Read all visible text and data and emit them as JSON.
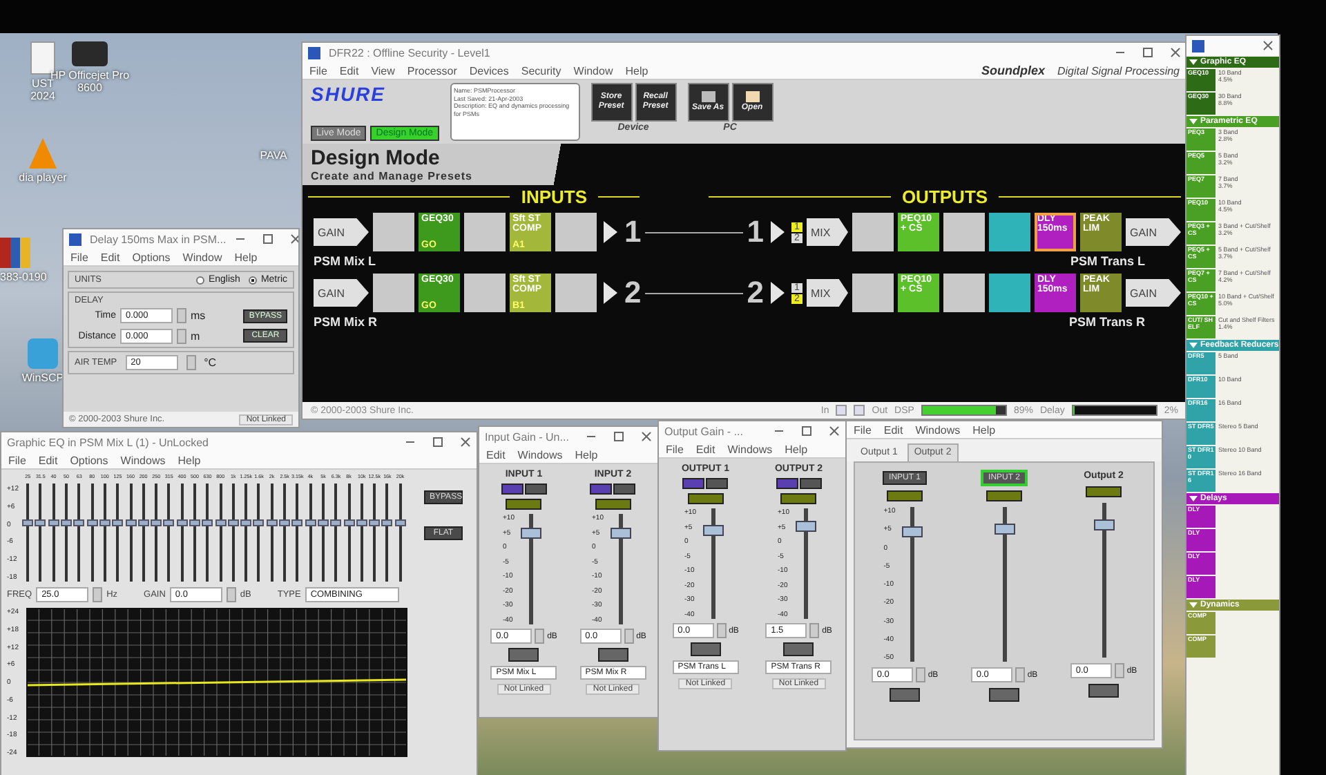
{
  "desktop_icons": [
    {
      "kind": "doc",
      "lines": [
        "UST",
        "2024"
      ]
    },
    {
      "kind": "printer",
      "lines": [
        "HP Officejet Pro",
        "8600"
      ]
    },
    {
      "kind": "cone",
      "lines": [
        "dia player"
      ]
    },
    {
      "kind": "archive",
      "lines": [
        "383-0190"
      ]
    },
    {
      "kind": "lock",
      "lines": [
        "WinSCP"
      ]
    },
    {
      "kind": "none",
      "lines": [
        "PAVA"
      ]
    }
  ],
  "main_window": {
    "title": "DFR22 : Offline Security - Level1",
    "menu": [
      "File",
      "Edit",
      "View",
      "Processor",
      "Devices",
      "Security",
      "Window",
      "Help"
    ],
    "brand": "Soundplex",
    "brand_sub": "Digital Signal Processing",
    "logo": "SHURE",
    "modes": [
      {
        "label": "Live Mode",
        "selected": false
      },
      {
        "label": "Design Mode",
        "selected": true
      }
    ],
    "notes": [
      "Name: PSMProcessor",
      "Last Saved: 21-Apr-2003",
      "Description: EQ and dynamics processing",
      "for PSMs"
    ],
    "device_buttons": [
      [
        "Store",
        "Preset"
      ],
      [
        "Recall",
        "Preset"
      ]
    ],
    "device_label": "Device",
    "pc_buttons": [
      {
        "kind": "disk",
        "label": "Save As"
      },
      {
        "kind": "folder",
        "label": "Open"
      }
    ],
    "pc_label": "PC",
    "banner_title": "Design Mode",
    "banner_subtitle": "Create and Manage Presets",
    "inputs_label": "INPUTS",
    "outputs_label": "OUTPUTS",
    "chains": [
      {
        "name": "PSM Mix L",
        "in_gain": "GAIN",
        "in_number": "1",
        "out_number": "1",
        "mix_label": "MIX",
        "out_gain": "GAIN",
        "out_name": "PSM Trans L",
        "in_blocks": [
          {
            "color": "#c9c9c9",
            "selected": false
          },
          {
            "color": "#3d9a1c",
            "label": "GEQ30",
            "sub": "GO",
            "selected": false
          },
          {
            "color": "#c9c9c9",
            "selected": false
          },
          {
            "color": "#a3b83a",
            "label": "Sft ST COMP",
            "sub": "A1",
            "selected": false
          },
          {
            "color": "#c9c9c9",
            "selected": false
          }
        ],
        "mix_inputs": [
          {
            "label": "1",
            "selected": true
          },
          {
            "label": "2",
            "selected": false
          }
        ],
        "out_blocks": [
          {
            "color": "#c9c9c9",
            "selected": false
          },
          {
            "color": "#5cc02a",
            "label": "PEQ10 + CS",
            "selected": false
          },
          {
            "color": "#c9c9c9",
            "selected": false
          },
          {
            "color": "#2fb3b8",
            "selected": false
          },
          {
            "color": "#b01fc0",
            "label": "DLY 150ms",
            "selected": true
          },
          {
            "color": "#7f8a2a",
            "label": "PEAK LIM",
            "selected": false
          }
        ]
      },
      {
        "name": "PSM Mix R",
        "in_gain": "GAIN",
        "in_number": "2",
        "out_number": "2",
        "mix_label": "MIX",
        "out_gain": "GAIN",
        "out_name": "PSM Trans R",
        "in_blocks": [
          {
            "color": "#c9c9c9",
            "selected": false
          },
          {
            "color": "#3d9a1c",
            "label": "GEQ30",
            "sub": "GO",
            "selected": false
          },
          {
            "color": "#c9c9c9",
            "selected": false
          },
          {
            "color": "#a3b83a",
            "label": "Sft ST COMP",
            "sub": "B1",
            "selected": false
          },
          {
            "color": "#c9c9c9",
            "selected": false
          }
        ],
        "mix_inputs": [
          {
            "label": "1",
            "selected": false
          },
          {
            "label": "2",
            "selected": true
          }
        ],
        "out_blocks": [
          {
            "color": "#c9c9c9",
            "selected": false
          },
          {
            "color": "#5cc02a",
            "label": "PEQ10 + CS",
            "selected": false
          },
          {
            "color": "#c9c9c9",
            "selected": false
          },
          {
            "color": "#2fb3b8",
            "selected": false
          },
          {
            "color": "#b01fc0",
            "label": "DLY 150ms",
            "selected": false
          },
          {
            "color": "#7f8a2a",
            "label": "PEAK LIM",
            "selected": false
          }
        ]
      }
    ],
    "status": {
      "copyright": "© 2000-2003 Shure Inc.",
      "in_label": "In",
      "out_label": "Out",
      "dsp_label": "DSP",
      "dsp_meter": {
        "level": 0.88
      },
      "dsp_value": "89%",
      "delay_label": "Delay",
      "delay_meter": {
        "level": 0.02
      },
      "delay_value": "2%"
    }
  },
  "delay_window": {
    "title": "Delay 150ms Max in PSM...",
    "menu": [
      "File",
      "Edit",
      "Options",
      "Window",
      "Help"
    ],
    "units_label": "UNITS",
    "units": [
      {
        "label": "English",
        "selected": false
      },
      {
        "label": "Metric",
        "selected": true
      }
    ],
    "delay_label": "DELAY",
    "fields": [
      {
        "label": "Time",
        "value": "0.000",
        "unit": "ms"
      },
      {
        "label": "Distance",
        "value": "0.000",
        "unit": "m"
      }
    ],
    "buttons": [
      "BYPASS",
      "CLEAR"
    ],
    "temp_label": "AIR TEMP",
    "temp_value": "20",
    "temp_unit": "°C",
    "copyright": "© 2000-2003 Shure Inc.",
    "link": "Not Linked"
  },
  "geq_window": {
    "title": "Graphic EQ in PSM Mix L (1) - UnLocked",
    "menu": [
      "File",
      "Edit",
      "Options",
      "Windows",
      "Help"
    ],
    "scale": [
      "+12",
      "+6",
      "0",
      "-6",
      "-12",
      "-18"
    ],
    "bands": [
      {
        "freq": "25",
        "level": 0.6
      },
      {
        "freq": "31.5",
        "level": 0.6
      },
      {
        "freq": "40",
        "level": 0.6
      },
      {
        "freq": "50",
        "level": 0.6
      },
      {
        "freq": "63",
        "level": 0.6
      },
      {
        "freq": "80",
        "level": 0.6
      },
      {
        "freq": "100",
        "level": 0.6
      },
      {
        "freq": "125",
        "level": 0.6
      },
      {
        "freq": "160",
        "level": 0.6
      },
      {
        "freq": "200",
        "level": 0.6
      },
      {
        "freq": "250",
        "level": 0.6
      },
      {
        "freq": "315",
        "level": 0.6
      },
      {
        "freq": "400",
        "level": 0.6
      },
      {
        "freq": "500",
        "level": 0.6
      },
      {
        "freq": "630",
        "level": 0.6
      },
      {
        "freq": "800",
        "level": 0.6
      },
      {
        "freq": "1k",
        "level": 0.6
      },
      {
        "freq": "1.25k",
        "level": 0.6
      },
      {
        "freq": "1.6k",
        "level": 0.6
      },
      {
        "freq": "2k",
        "level": 0.6
      },
      {
        "freq": "2.5k",
        "level": 0.6
      },
      {
        "freq": "3.15k",
        "level": 0.6
      },
      {
        "freq": "4k",
        "level": 0.6
      },
      {
        "freq": "5k",
        "level": 0.6
      },
      {
        "freq": "6.3k",
        "level": 0.6
      },
      {
        "freq": "8k",
        "level": 0.6
      },
      {
        "freq": "10k",
        "level": 0.6
      },
      {
        "freq": "12.5k",
        "level": 0.6
      },
      {
        "freq": "16k",
        "level": 0.6
      },
      {
        "freq": "20k",
        "level": 0.6
      }
    ],
    "fields": [
      {
        "label": "FREQ",
        "value": "25.0",
        "unit": "Hz"
      },
      {
        "label": "GAIN",
        "value": "0.0",
        "unit": "dB"
      }
    ],
    "type_label": "TYPE",
    "type_value": "COMBINING",
    "graph_scale": [
      "+24",
      "+18",
      "+12",
      "+6",
      "0",
      "-6",
      "-12",
      "-18",
      "-24"
    ],
    "top_buttons": [
      "BYPASS",
      "FLAT"
    ]
  },
  "input_gain_window": {
    "title": "Input Gain - Un...",
    "menu": [
      "Edit",
      "Windows",
      "Help"
    ],
    "channels": [
      {
        "name": "INPUT 1",
        "scale": [
          "+10",
          "+5",
          "0",
          "-5",
          "-10",
          "-20",
          "-30",
          "-40"
        ],
        "level": 0.82,
        "value": "0.0",
        "unit": "dB",
        "preset": "PSM Mix L",
        "link": "Not Linked"
      },
      {
        "name": "INPUT 2",
        "scale": [
          "+10",
          "+5",
          "0",
          "-5",
          "-10",
          "-20",
          "-30",
          "-40"
        ],
        "level": 0.82,
        "value": "0.0",
        "unit": "dB",
        "preset": "PSM Mix R",
        "link": "Not Linked"
      }
    ]
  },
  "output_gain_window": {
    "title": "Output Gain - ...",
    "menu": [
      "File",
      "Edit",
      "Windows",
      "Help"
    ],
    "channels": [
      {
        "name": "OUTPUT 1",
        "scale": [
          "+10",
          "+5",
          "0",
          "-5",
          "-10",
          "-20",
          "-30",
          "-40"
        ],
        "level": 0.8,
        "value": "0.0",
        "unit": "dB",
        "preset": "PSM Trans L",
        "link": "Not Linked"
      },
      {
        "name": "OUTPUT 2",
        "scale": [
          "+10",
          "+5",
          "0",
          "-5",
          "-10",
          "-20",
          "-30",
          "-40"
        ],
        "level": 0.84,
        "value": "1.5",
        "unit": "dB",
        "preset": "PSM Trans R",
        "link": "Not Linked"
      }
    ]
  },
  "mixer_window": {
    "menu": [
      "File",
      "Edit",
      "Windows",
      "Help"
    ],
    "tabs": [
      {
        "label": "Output 1",
        "selected": false
      },
      {
        "label": "Output 2",
        "selected": true
      }
    ],
    "scale": [
      "+10",
      "+5",
      "0",
      "-5",
      "-10",
      "-20",
      "-30",
      "-40",
      "-50"
    ],
    "channels": [
      {
        "kind": "input",
        "name": "INPUT 1",
        "selected": false,
        "level": 0.84,
        "value": "0.0",
        "unit": "dB"
      },
      {
        "kind": "input",
        "name": "INPUT 2",
        "selected": true,
        "level": 0.86,
        "value": "0.0",
        "unit": "dB"
      },
      {
        "kind": "output",
        "name": "Output 2",
        "level": 0.86,
        "value": "0.0",
        "unit": "dB"
      }
    ]
  },
  "palette": {
    "sections": [
      {
        "title": "Graphic EQ",
        "color": "#2e6b16",
        "expanded": true,
        "items": [
          {
            "code": "GEQ10",
            "label": "10 Band",
            "usage": "4.5%"
          },
          {
            "code": "GEQ30",
            "label": "30 Band",
            "usage": "8.8%"
          }
        ]
      },
      {
        "title": "Parametric EQ",
        "color": "#4aa024",
        "expanded": true,
        "items": [
          {
            "code": "PEQ3",
            "label": "3 Band",
            "usage": "2.8%"
          },
          {
            "code": "PEQ5",
            "label": "5 Band",
            "usage": "3.2%"
          },
          {
            "code": "PEQ7",
            "label": "7 Band",
            "usage": "3.7%"
          },
          {
            "code": "PEQ10",
            "label": "10 Band",
            "usage": "4.5%"
          },
          {
            "code": "PEQ3 +CS",
            "label": "3 Band + Cut/Shelf",
            "usage": "3.2%"
          },
          {
            "code": "PEQ5 +CS",
            "label": "5 Band + Cut/Shelf",
            "usage": "3.7%"
          },
          {
            "code": "PEQ7 +CS",
            "label": "7 Band + Cut/Shelf",
            "usage": "4.2%"
          },
          {
            "code": "PEQ10 +CS",
            "label": "10 Band + Cut/Shelf",
            "usage": "5.0%"
          },
          {
            "code": "CUT/ SHELF",
            "label": "Cut and Shelf Filters",
            "usage": "1.4%"
          }
        ]
      },
      {
        "title": "Feedback Reducers",
        "color": "#2fa3a8",
        "expanded": true,
        "items": [
          {
            "code": "DFR5",
            "label": "5 Band"
          },
          {
            "code": "DFR10",
            "label": "10 Band"
          },
          {
            "code": "DFR16",
            "label": "16 Band"
          },
          {
            "code": "ST DFR5",
            "label": "Stereo 5 Band"
          },
          {
            "code": "ST DFR10",
            "label": "Stereo 10 Band"
          },
          {
            "code": "ST DFR16",
            "label": "Stereo 16 Band"
          }
        ]
      },
      {
        "title": "Delays",
        "color": "#a619b8",
        "expanded": true,
        "items": [
          {
            "code": "DLY"
          },
          {
            "code": "DLY"
          },
          {
            "code": "DLY"
          },
          {
            "code": "DLY"
          }
        ]
      },
      {
        "title": "Dynamics",
        "color": "#8a9a3a",
        "expanded": true,
        "items": [
          {
            "code": "COMP"
          },
          {
            "code": "COMP"
          }
        ]
      }
    ]
  }
}
